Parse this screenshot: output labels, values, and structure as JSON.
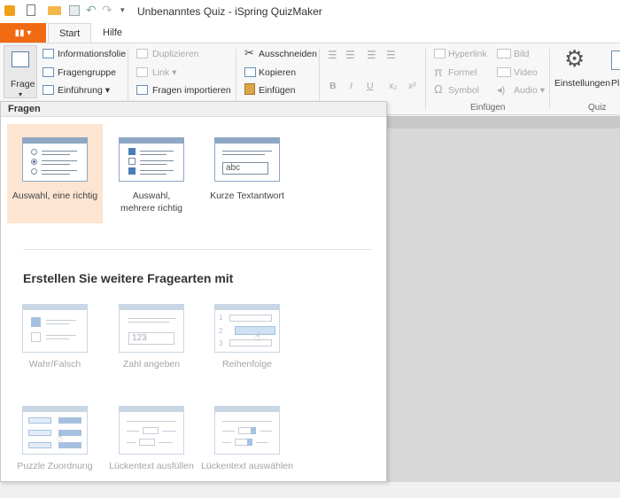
{
  "window": {
    "title": "Unbenanntes Quiz - iSpring QuizMaker"
  },
  "tabs": {
    "file_label": "▮▮ ▾",
    "start": "Start",
    "hilfe": "Hilfe"
  },
  "ribbon": {
    "frage": "Frage",
    "informationsfolie": "Informationsfolie",
    "fragengruppe": "Fragengruppe",
    "einfuehrung": "Einführung ▾",
    "duplizieren": "Duplizieren",
    "link": "Link ▾",
    "fragen_importieren": "Fragen importieren",
    "ausschneiden": "Ausschneiden",
    "kopieren": "Kopieren",
    "einfuegen": "Einfügen",
    "bold": "B",
    "italic": "I",
    "underline": "U",
    "subscript": "x₂",
    "superscript": "x²",
    "hyperlink": "Hyperlink",
    "formel": "Formel",
    "symbol": "Symbol",
    "bild": "Bild",
    "video": "Video",
    "audio": "Audio ▾",
    "einfuegen_group": "Einfügen",
    "einstellungen": "Einstellungen",
    "quiz_group": "Quiz",
    "pl_fragment": "Pl"
  },
  "panel": {
    "header": "Fragen",
    "items": [
      {
        "label": "Auswahl, eine richtig"
      },
      {
        "label": "Auswahl, mehrere richtig"
      },
      {
        "label": "Kurze Textantwort",
        "input_text": "abc"
      }
    ],
    "more_title": "Erstellen Sie weitere Fragearten mit",
    "more_items": [
      {
        "label": "Wahr/Falsch"
      },
      {
        "label": "Zahl angeben",
        "input_text": "123"
      },
      {
        "label": "Reihenfolge",
        "nums": [
          "1",
          "2",
          "3"
        ]
      },
      {
        "label": "Puzzle Zuordnung"
      },
      {
        "label": "Lückentext ausfüllen"
      },
      {
        "label": "Lückentext auswählen"
      }
    ]
  },
  "colors": {
    "accent": "#f06a13",
    "selected": "#fde5d2",
    "icon_blue": "#8ea8c4"
  }
}
